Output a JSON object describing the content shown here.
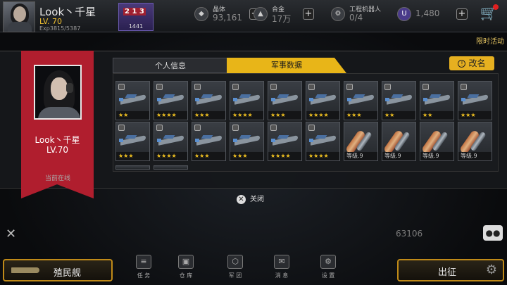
{
  "player": {
    "name": "Look丶千星",
    "level": "LV. 70",
    "exp": "Exp3815/5387",
    "rank_badge": "2 1 3",
    "rank_value": "1441"
  },
  "resources": [
    {
      "icon": "crystal-icon",
      "label": "晶体",
      "value": "93,161"
    },
    {
      "icon": "alloy-icon",
      "label": "合金",
      "value": "17万"
    },
    {
      "icon": "robot-icon",
      "label": "工程机器人",
      "value": "0/4"
    },
    {
      "icon": "u-currency-icon",
      "label": "",
      "value": "1,480"
    }
  ],
  "limited_event": "限时活动",
  "profile": {
    "name": "Look丶千星",
    "level": "LV.70",
    "status": "当前在线"
  },
  "tabs": {
    "info": "个人信息",
    "military": "军事数据"
  },
  "rename_label": "改名",
  "row1_stars": [
    "★★",
    "★★★★",
    "★★★",
    "★★★★",
    "★★★",
    "★★★★",
    "★★★",
    "★★",
    "★★",
    "★★★"
  ],
  "row2_labels": [
    "★★★",
    "★★★★",
    "★★★",
    "★★★",
    "★★★★",
    "★★★★",
    "等级.9",
    "等级.9",
    "等级.9",
    "等级.9"
  ],
  "close_label": "关闭",
  "power_value": "63106",
  "colony_label": "殖民舰",
  "go_label": "出征",
  "nav": [
    {
      "icon": "task-icon",
      "label": "任 务"
    },
    {
      "icon": "warehouse-icon",
      "label": "仓 库"
    },
    {
      "icon": "legion-icon",
      "label": "军 团"
    },
    {
      "icon": "message-icon",
      "label": "消 息"
    },
    {
      "icon": "settings-icon",
      "label": "设 置"
    }
  ]
}
